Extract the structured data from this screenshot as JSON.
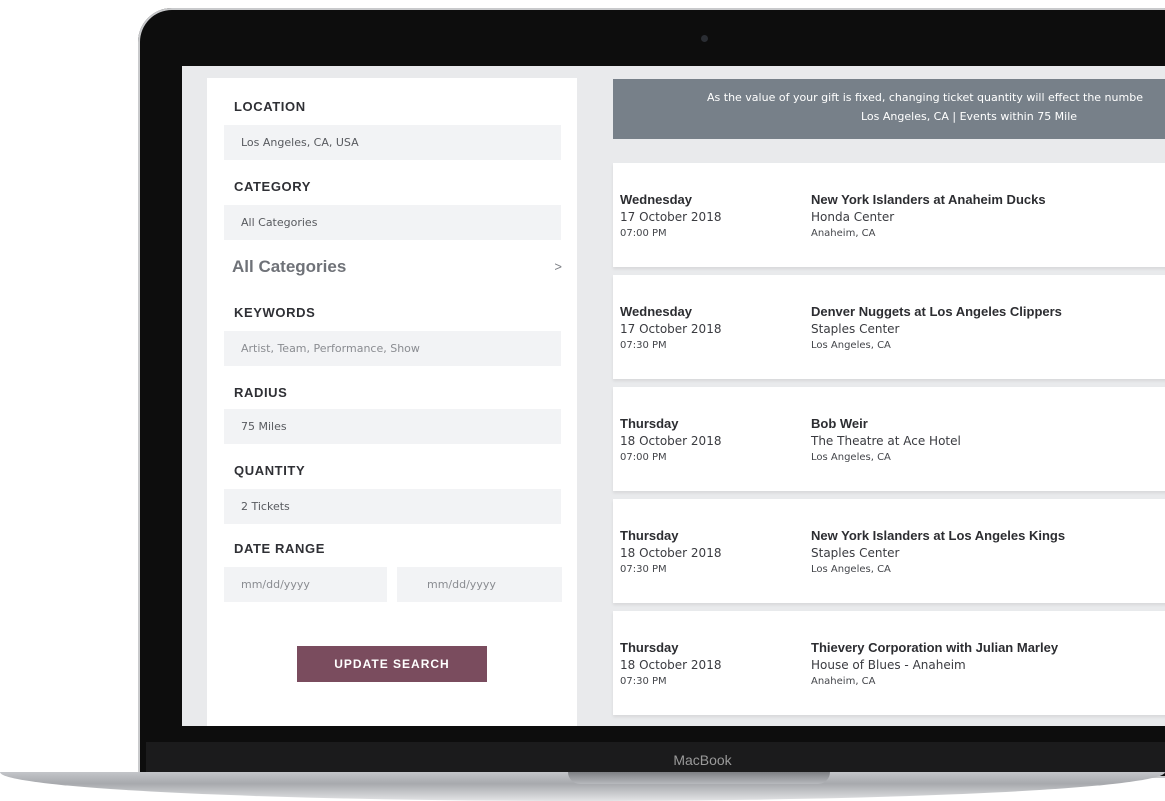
{
  "device": {
    "brand": "MacBook"
  },
  "sidebar": {
    "location": {
      "label": "LOCATION",
      "value": "Los Angeles, CA, USA"
    },
    "category": {
      "label": "CATEGORY",
      "value": "All Categories",
      "link_label": "All Categories",
      "chevron": ">"
    },
    "keywords": {
      "label": "KEYWORDS",
      "placeholder": "Artist, Team, Performance, Show"
    },
    "radius": {
      "label": "RADIUS",
      "value": "75 Miles"
    },
    "quantity": {
      "label": "QUANTITY",
      "value": "2 Tickets"
    },
    "date_range": {
      "label": "DATE RANGE",
      "start_placeholder": "mm/dd/yyyy",
      "end_placeholder": "mm/dd/yyyy"
    },
    "update_button": "UPDATE SEARCH"
  },
  "banner": {
    "line1": "As the value of your gift is fixed, changing ticket quantity will effect the numbe",
    "line2": "Los Angeles, CA | Events within 75 Mile"
  },
  "events": [
    {
      "day": "Wednesday",
      "date": "17 October 2018",
      "time": "07:00 PM",
      "name": "New York Islanders at Anaheim Ducks",
      "venue": "Honda Center",
      "city": "Anaheim, CA"
    },
    {
      "day": "Wednesday",
      "date": "17 October 2018",
      "time": "07:30 PM",
      "name": "Denver Nuggets at Los Angeles Clippers",
      "venue": "Staples Center",
      "city": "Los Angeles, CA"
    },
    {
      "day": "Thursday",
      "date": "18 October 2018",
      "time": "07:00 PM",
      "name": "Bob Weir",
      "venue": "The Theatre at Ace Hotel",
      "city": "Los Angeles, CA"
    },
    {
      "day": "Thursday",
      "date": "18 October 2018",
      "time": "07:30 PM",
      "name": "New York Islanders at Los Angeles Kings",
      "venue": "Staples Center",
      "city": "Los Angeles, CA"
    },
    {
      "day": "Thursday",
      "date": "18 October 2018",
      "time": "07:30 PM",
      "name": "Thievery Corporation with Julian Marley",
      "venue": "House of Blues - Anaheim",
      "city": "Anaheim, CA"
    }
  ]
}
